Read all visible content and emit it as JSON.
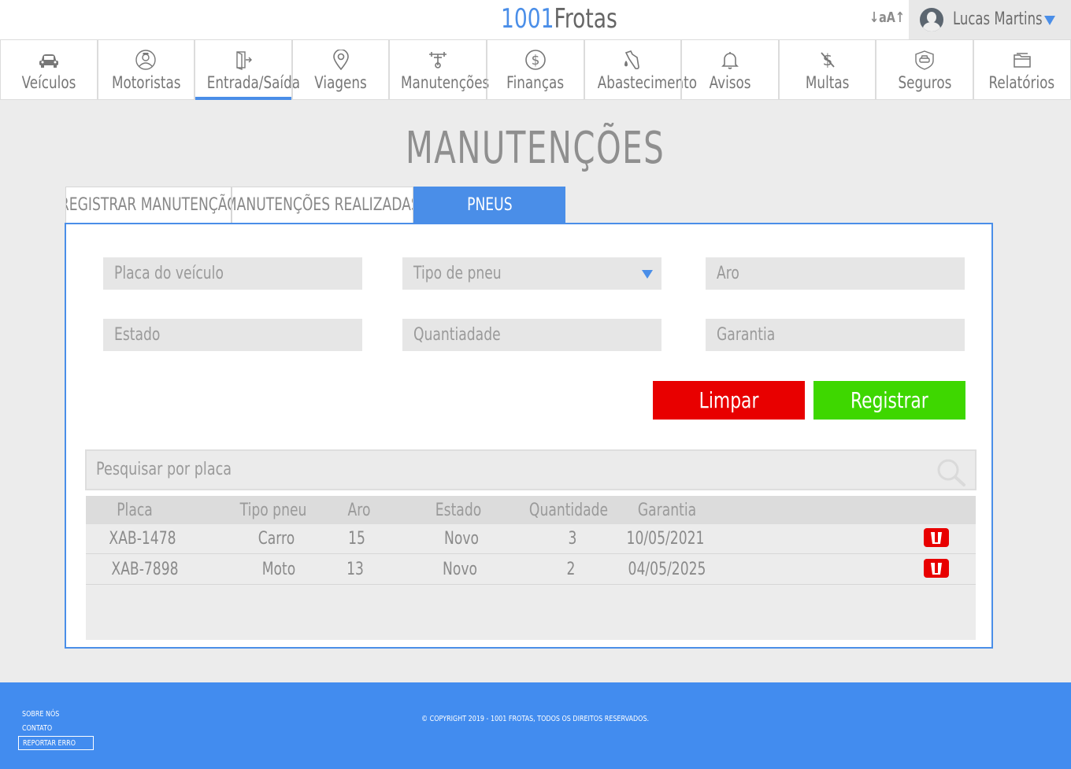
{
  "header": {
    "logo_number": "1001",
    "logo_text": "Frotas",
    "font_size_control": "↓aA↑",
    "user_name": "Lucas Martins"
  },
  "nav": {
    "items": [
      {
        "label": "Veículos",
        "icon": "car-icon"
      },
      {
        "label": "Motoristas",
        "icon": "driver-icon"
      },
      {
        "label": "Entrada/Saída",
        "icon": "door-exit-icon"
      },
      {
        "label": "Viagens",
        "icon": "map-pin-icon"
      },
      {
        "label": "Manutenções",
        "icon": "wrench-icon"
      },
      {
        "label": "Finanças",
        "icon": "dollar-icon"
      },
      {
        "label": "Abastecimento",
        "icon": "fuel-nozzle-icon"
      },
      {
        "label": "Avisos",
        "icon": "bell-icon"
      },
      {
        "label": "Multas",
        "icon": "fine-icon"
      },
      {
        "label": "Seguros",
        "icon": "insurance-car-icon"
      },
      {
        "label": "Relatórios",
        "icon": "folder-icon"
      }
    ],
    "active": "Entrada/Saída"
  },
  "page": {
    "title": "MANUTENÇÕES"
  },
  "tabs": [
    {
      "label": "REGISTRAR MANUTENÇÃO"
    },
    {
      "label": "MANUTENÇÕES REALIZADAS"
    },
    {
      "label": "PNEUS"
    }
  ],
  "form": {
    "plate_placeholder": "Placa do veículo",
    "tire_type_placeholder": "Tipo de pneu",
    "rim_placeholder": "Aro",
    "state_placeholder": "Estado",
    "quantity_placeholder": "Quantiadade",
    "warranty_placeholder": "Garantia",
    "clear_label": "Limpar",
    "register_label": "Registrar"
  },
  "search": {
    "placeholder": "Pesquisar por placa"
  },
  "table": {
    "headers": [
      "Placa",
      "Tipo pneu",
      "Aro",
      "Estado",
      "Quantidade",
      "Garantia"
    ],
    "rows": [
      [
        "XAB-1478",
        "Carro",
        "15",
        "Novo",
        "3",
        "10/05/2021"
      ],
      [
        "XAB-7898",
        "Moto",
        "13",
        "Novo",
        "2",
        "04/05/2025"
      ]
    ]
  },
  "footer": {
    "about": "SOBRE NÓS",
    "contact": "CONTATO",
    "report_error": "REPORTAR ERRO",
    "copyright": "© COPYRIGHT 2019 - 1001 FROTAS, TODOS OS DIREITOS RESERVADOS."
  },
  "colors": {
    "accent": "#4a8ee8",
    "clear": "#e80000",
    "register": "#3ed700",
    "footer": "#428cef"
  }
}
